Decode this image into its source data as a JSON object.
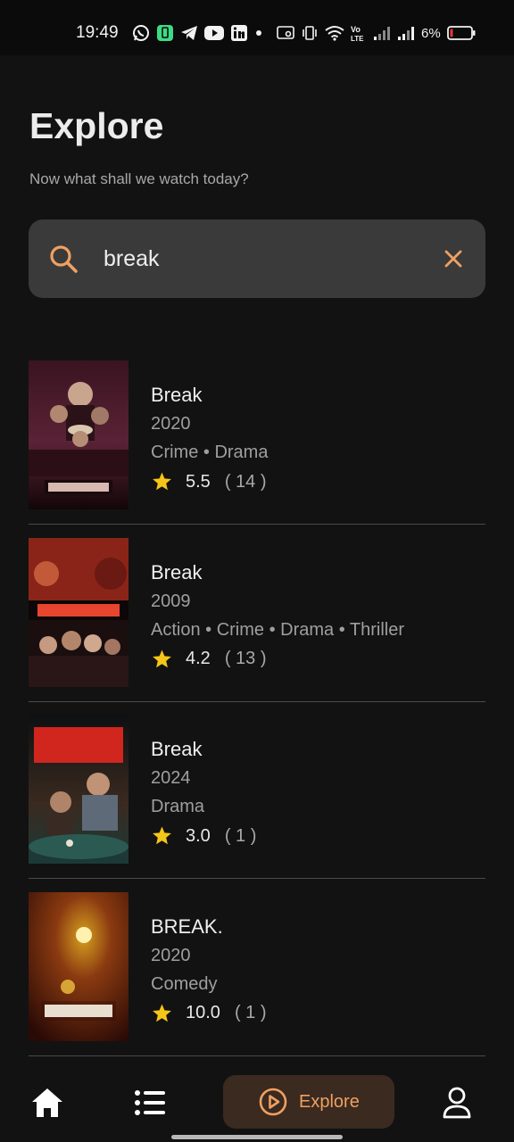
{
  "status_bar": {
    "time": "19:49",
    "battery_percent": "6%",
    "icons": [
      "whatsapp-icon",
      "battery-saver-icon",
      "telegram-icon",
      "youtube-icon",
      "linkedin-icon",
      "dot-icon",
      "cast-icon",
      "vibrate-icon",
      "wifi-icon",
      "volte-icon",
      "signal-icon",
      "signal-icon",
      "battery-icon"
    ]
  },
  "header": {
    "title": "Explore",
    "subtitle": "Now what shall we watch today?"
  },
  "search": {
    "value": "break",
    "search_icon": "search-icon",
    "clear_icon": "close-icon"
  },
  "results": [
    {
      "title": "Break",
      "year": "2020",
      "genres": "Crime • Drama",
      "rating": "5.5",
      "votes": "( 14 )"
    },
    {
      "title": "Break",
      "year": "2009",
      "genres": "Action • Crime • Drama • Thriller",
      "rating": "4.2",
      "votes": "( 13 )"
    },
    {
      "title": "Break",
      "year": "2024",
      "genres": "Drama",
      "rating": "3.0",
      "votes": "( 1 )"
    },
    {
      "title": "BREAK.",
      "year": "2020",
      "genres": "Comedy",
      "rating": "10.0",
      "votes": "( 1 )"
    }
  ],
  "bottom_nav": {
    "home_icon": "home-icon",
    "list_icon": "list-icon",
    "explore_label": "Explore",
    "explore_icon": "play-circle-icon",
    "profile_icon": "profile-icon"
  },
  "colors": {
    "accent": "#f0a060",
    "background": "#121212",
    "star": "#f5c518",
    "search_bg": "#3a3a3a"
  }
}
